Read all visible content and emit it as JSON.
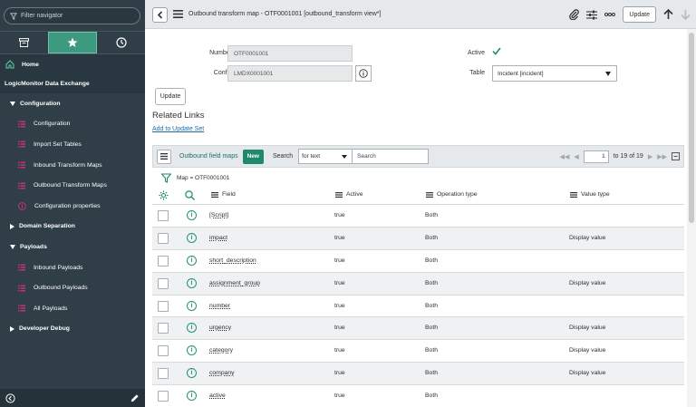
{
  "sidebar": {
    "filter_placeholder": "Filter navigator",
    "tabs": [
      "all-apps",
      "favorites",
      "history"
    ],
    "items": [
      {
        "type": "home",
        "label": "Home"
      },
      {
        "type": "app",
        "label": "LogicMonitor Data Exchange"
      },
      {
        "type": "section",
        "label": "Configuration",
        "expanded": true
      },
      {
        "type": "module",
        "label": "Configuration",
        "icon": "list-icon"
      },
      {
        "type": "module",
        "label": "Import Set Tables",
        "icon": "list-icon"
      },
      {
        "type": "module",
        "label": "Inbound Transform Maps",
        "icon": "list-icon"
      },
      {
        "type": "module",
        "label": "Outbound Transform Maps",
        "icon": "list-icon"
      },
      {
        "type": "module",
        "label": "Configuration properties",
        "icon": "info-icon"
      },
      {
        "type": "section",
        "label": "Domain Separation",
        "expanded": false
      },
      {
        "type": "section",
        "label": "Payloads",
        "expanded": true
      },
      {
        "type": "module",
        "label": "Inbound Payloads",
        "icon": "list-icon"
      },
      {
        "type": "module",
        "label": "Outbound Payloads",
        "icon": "list-icon"
      },
      {
        "type": "module",
        "label": "All Payloads",
        "icon": "list-icon"
      },
      {
        "type": "section",
        "label": "Developer Debug",
        "expanded": false
      }
    ]
  },
  "header": {
    "title": "Outbound transform map - OTF0001001 [outbound_transform view*]",
    "update_label": "Update"
  },
  "form": {
    "number_label": "Number",
    "number_value": "OTF0001001",
    "config_label": "Config",
    "config_value": "LMDX0001001",
    "active_label": "Active",
    "active_checked": true,
    "table_label": "Table",
    "table_value": "Incident [incident]",
    "update_label": "Update"
  },
  "related": {
    "title": "Related Links",
    "add_link": "Add to Update Set"
  },
  "list": {
    "title": "Outbound field maps",
    "new_label": "New",
    "search_label": "Search",
    "search_field": "for text",
    "search_placeholder": "Search",
    "page_value": "1",
    "page_range": "to 19 of 19",
    "filter_text": "Map = OTF0001001",
    "columns": [
      "Field",
      "Active",
      "Operation type",
      "Value type"
    ],
    "rows": [
      {
        "field": "[Script]",
        "active": "true",
        "op": "Both",
        "vt": ""
      },
      {
        "field": "impact",
        "active": "true",
        "op": "Both",
        "vt": "Display value"
      },
      {
        "field": "short_description",
        "active": "true",
        "op": "Both",
        "vt": ""
      },
      {
        "field": "assignment_group",
        "active": "true",
        "op": "Both",
        "vt": "Display value"
      },
      {
        "field": "number",
        "active": "true",
        "op": "Both",
        "vt": ""
      },
      {
        "field": "urgency",
        "active": "true",
        "op": "Both",
        "vt": "Display value"
      },
      {
        "field": "category",
        "active": "true",
        "op": "Both",
        "vt": "Display value"
      },
      {
        "field": "company",
        "active": "true",
        "op": "Both",
        "vt": "Display value"
      },
      {
        "field": "active",
        "active": "true",
        "op": "Both",
        "vt": ""
      }
    ]
  },
  "colors": {
    "sidebar_bg": "#2f3e47",
    "accent": "#1e8a6b",
    "module_icon": "#c2347a"
  }
}
